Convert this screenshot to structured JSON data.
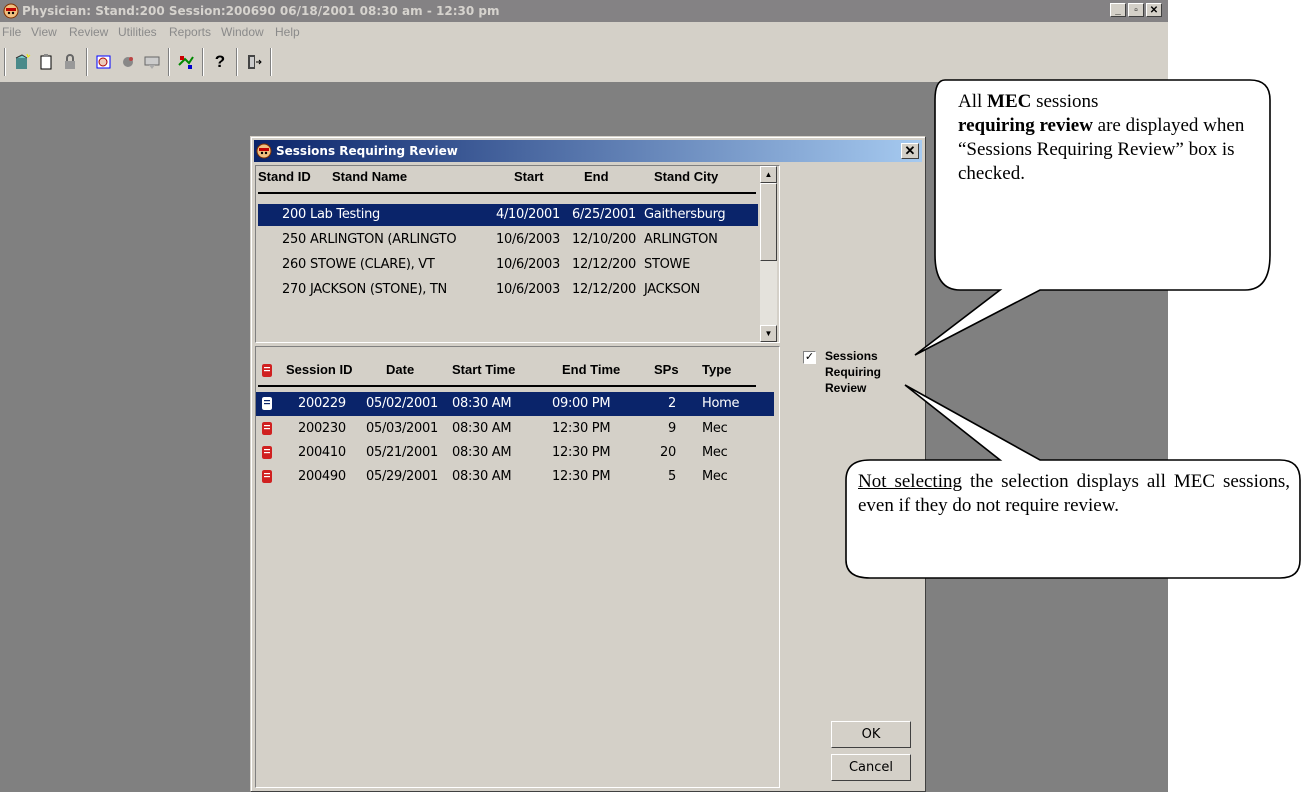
{
  "window": {
    "title": "Physician: Stand:200 Session:200690 06/18/2001 08:30 am - 12:30 pm",
    "min": "_",
    "max": "▫",
    "close": "✕"
  },
  "menu": [
    "File",
    "View",
    "Review",
    "Utilities",
    "Reports",
    "Window",
    "Help"
  ],
  "toolbar": {
    "icons": [
      "new-icon",
      "clipboard-icon",
      "lock-icon",
      "review-icon",
      "hand-icon",
      "tools-icon",
      "exchange-icon",
      "help-icon",
      "exit-icon"
    ]
  },
  "dialog": {
    "title": "Sessions Requiring Review",
    "close": "✕",
    "stands": {
      "headers": {
        "id": "Stand ID",
        "name": "Stand Name",
        "start": "Start",
        "end": "End",
        "city": "Stand City"
      },
      "rows": [
        {
          "id": "200",
          "name": "Lab Testing",
          "start": "4/10/2001",
          "end": "6/25/2001",
          "city": "Gaithersburg",
          "selected": true
        },
        {
          "id": "250",
          "name": "ARLINGTON (ARLINGTO",
          "start": "10/6/2003",
          "end": "12/10/200",
          "city": "ARLINGTON",
          "selected": false
        },
        {
          "id": "260",
          "name": "STOWE (CLARE), VT",
          "start": "10/6/2003",
          "end": "12/12/200",
          "city": "STOWE",
          "selected": false
        },
        {
          "id": "270",
          "name": "JACKSON (STONE), TN",
          "start": "10/6/2003",
          "end": "12/12/200",
          "city": "JACKSON",
          "selected": false
        }
      ]
    },
    "sessions": {
      "headers": {
        "id": "Session ID",
        "date": "Date",
        "start": "Start Time",
        "end": "End Time",
        "sps": "SPs",
        "type": "Type"
      },
      "rows": [
        {
          "id": "200229",
          "date": "05/02/2001",
          "start": "08:30 AM",
          "end": "09:00 PM",
          "sps": "2",
          "type": "Home",
          "selected": true
        },
        {
          "id": "200230",
          "date": "05/03/2001",
          "start": "08:30 AM",
          "end": "12:30 PM",
          "sps": "9",
          "type": "Mec",
          "selected": false
        },
        {
          "id": "200410",
          "date": "05/21/2001",
          "start": "08:30 AM",
          "end": "12:30 PM",
          "sps": "20",
          "type": "Mec",
          "selected": false
        },
        {
          "id": "200490",
          "date": "05/29/2001",
          "start": "08:30 AM",
          "end": "12:30 PM",
          "sps": "5",
          "type": "Mec",
          "selected": false
        }
      ]
    },
    "checkbox": {
      "checked": true,
      "mark": "✓",
      "label1": "Sessions",
      "label2": "Requiring",
      "label3": "Review"
    },
    "ok": "OK",
    "cancel": "Cancel"
  },
  "callouts": {
    "top": {
      "p1": "All ",
      "b1": "MEC",
      "p2": " sessions",
      "b2": "requiring review",
      "p3": " are displayed when “Sessions Requiring Review” box is checked."
    },
    "bottom": {
      "u": "Not selecting",
      "rest": " the selection displays all MEC sessions, even if they do not require review."
    }
  },
  "colors": {
    "selection": "#0a246a",
    "book_red": "#d02020",
    "face": "#d4d0c8",
    "desktop": "#808080"
  }
}
